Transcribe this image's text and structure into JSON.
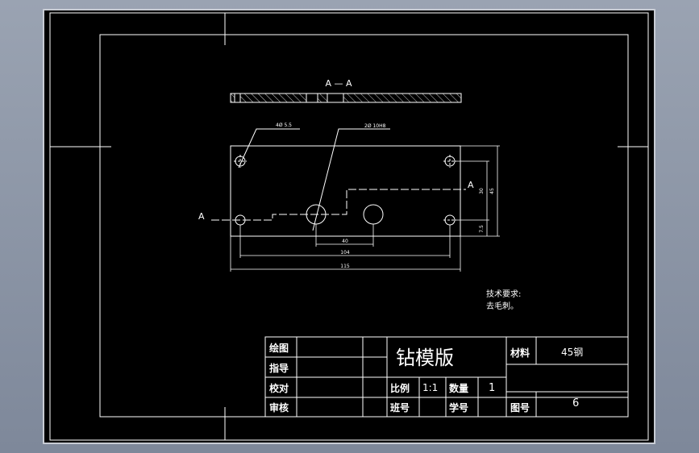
{
  "colors": {
    "background": "#000000",
    "line": "#ffffff",
    "viewport_frame": "#c8ccd4",
    "app_background": "#8b94a4"
  },
  "section_view": {
    "label": "A — A"
  },
  "callouts": {
    "small_holes": "4Ø 5.5",
    "large_holes": "2Ø 10H8"
  },
  "section_markers": {
    "left": "A",
    "right": "A"
  },
  "dimensions": {
    "hole_spacing": "40",
    "small_hole_spacing": "104",
    "overall_width": "115",
    "vertical_inner": "30",
    "vertical_overall": "45",
    "vertical_edge": "7.5"
  },
  "technical_requirements": {
    "title": "技术要求:",
    "item": "去毛刺。"
  },
  "title_block": {
    "draw_label": "绘图",
    "guide_label": "指导",
    "check_label": "校对",
    "review_label": "审核",
    "part_name": "钻模版",
    "material_label": "材料",
    "material_value": "45钢",
    "scale_label": "比例",
    "scale_value": "1:1",
    "quantity_label": "数量",
    "quantity_value": "1",
    "class_label": "班号",
    "student_label": "学号",
    "drawing_no_label": "图号",
    "drawing_no_value": "6"
  }
}
